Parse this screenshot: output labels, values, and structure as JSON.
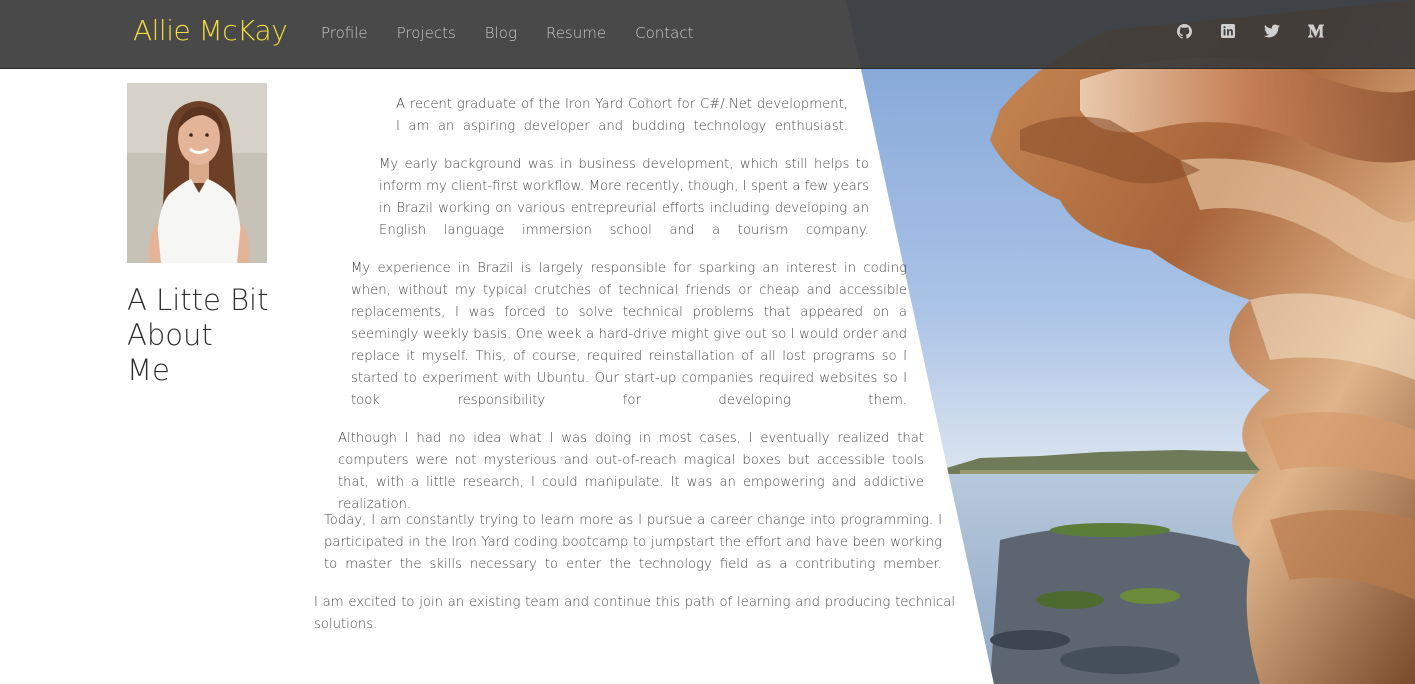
{
  "brand": {
    "name": "Allie McKay",
    "color": "#f2dd3f"
  },
  "nav": {
    "items": [
      {
        "label": "Profile"
      },
      {
        "label": "Projects"
      },
      {
        "label": "Blog"
      },
      {
        "label": "Resume"
      },
      {
        "label": "Contact"
      }
    ]
  },
  "social": {
    "icons": [
      "github-icon",
      "linkedin-icon",
      "twitter-icon",
      "medium-icon"
    ]
  },
  "about": {
    "heading": "A Litte Bit About Me",
    "heading_lines": [
      "A Litte Bit",
      "About",
      "Me"
    ],
    "paragraphs": [
      "A recent graduate of the Iron Yard Cohort for C#/.Net development, I am an aspiring developer and budding technology enthusiast.",
      "My early background was in business development, which still helps to inform my client-first workflow. More recently, though, I spent a few years in Brazil working on various entrepreurial efforts including developing an English language immersion school and a tourism company.",
      "My experience in Brazil is largely responsible for sparking an interest in coding when, without my typical crutches of technical friends or cheap and accessible replacements, I was forced to solve technical problems that appeared on a seemingly weekly basis. One week a hard-drive might give out so I would order and replace it myself. This, of course, required reinstallation of all lost programs so I started to experiment with Ubuntu. Our start-up companies required websites so I took responsibility for developing them.",
      "Although I had no idea what I was doing in most cases, I eventually realized that computers were not mysterious and out-of-reach magical boxes but accessible tools that, with a little research, I could manipulate. It was an empowering and addictive realization.",
      "Today, I am constantly trying to learn more as I pursue a career change into programming. I participated in the Iron Yard coding bootcamp to jumpstart the effort and have been working to master the skills necessary to enter the technology field as a contributing member.",
      "I am excited to join an existing team and continue this path of learning and producing technical solutions."
    ]
  }
}
